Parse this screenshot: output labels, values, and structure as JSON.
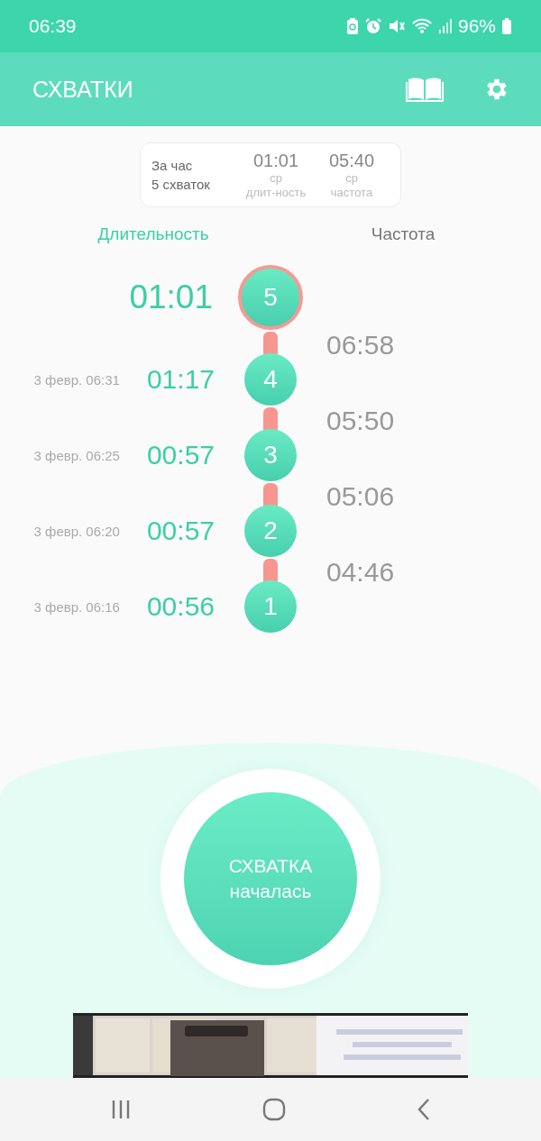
{
  "status_bar": {
    "time": "06:39",
    "battery": "96%"
  },
  "app_bar": {
    "title": "СХВАТКИ"
  },
  "summary": {
    "period": "За час",
    "count": "5 схваток",
    "avg_duration": "01:01",
    "avg_duration_label_1": "ср",
    "avg_duration_label_2": "длит-ность",
    "avg_frequency": "05:40",
    "avg_frequency_label_1": "ср",
    "avg_frequency_label_2": "частота"
  },
  "columns": {
    "duration": "Длительность",
    "frequency": "Частота"
  },
  "contractions": [
    {
      "number": "5",
      "duration": "01:01",
      "latest": true,
      "frequency_after": "06:58"
    },
    {
      "number": "4",
      "date": "3 февр. 06:31",
      "duration": "01:17",
      "latest": false,
      "frequency_after": "05:50"
    },
    {
      "number": "3",
      "date": "3 февр. 06:25",
      "duration": "00:57",
      "latest": false,
      "frequency_after": "05:06"
    },
    {
      "number": "2",
      "date": "3 февр. 06:20",
      "duration": "00:57",
      "latest": false,
      "frequency_after": "04:46"
    },
    {
      "number": "1",
      "date": "3 февр. 06:16",
      "duration": "00:56",
      "latest": false
    }
  ],
  "start_button": {
    "line_1": "СХВАТКА",
    "line_2": "началась"
  }
}
